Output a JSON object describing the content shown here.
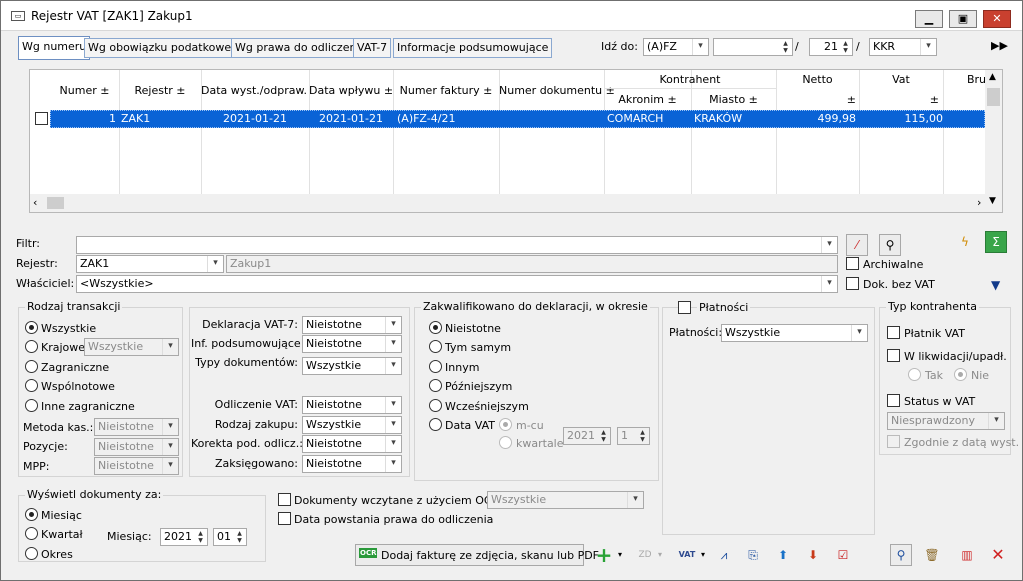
{
  "title": "Rejestr VAT  [ZAK1]  Zakup1",
  "tabs": [
    "Wg numeru",
    "Wg obowiązku podatkowego",
    "Wg prawa do odliczenia",
    "VAT-7",
    "Informacje podsumowujące"
  ],
  "goto": {
    "label": "Idź do:",
    "type": "(A)FZ",
    "number": "",
    "sep1": "/",
    "month": "21",
    "sep2": "/",
    "series": "KKR"
  },
  "grid": {
    "headers": {
      "numer": "Numer ±",
      "rejestr": "Rejestr ±",
      "data_wyst": "Data wyst./odpraw. ±",
      "data_wplywu": "Data wpływu ±",
      "nr_faktury": "Numer faktury ±",
      "nr_dok": "Numer dokumentu ±",
      "kontrahent": "Kontrahent",
      "akronim": "Akronim ±",
      "miasto": "Miasto ±",
      "netto": "Netto",
      "netto_sort": "±",
      "vat": "Vat",
      "vat_sort": "±",
      "brutto": "Bru"
    },
    "row": {
      "numer": "1",
      "rejestr": "ZAK1",
      "data_wyst": "2021-01-21",
      "data_wplywu": "2021-01-21",
      "nr_faktury": "(A)FZ-4/21",
      "nr_dok": "",
      "akronim": "COMARCH",
      "miasto": "KRAKÓW",
      "netto": "499,98",
      "vat": "115,00"
    }
  },
  "filter": {
    "filtr_label": "Filtr:",
    "filtr_value": "",
    "rejestr_label": "Rejestr:",
    "rejestr_value": "ZAK1",
    "rejestr_name": "Zakup1",
    "wlasciciel_label": "Właściciel:",
    "wlasciciel_value": "<Wszystkie>",
    "archiwalne": "Archiwalne",
    "dok_bez_vat": "Dok. bez VAT"
  },
  "rodzaj": {
    "title": "Rodzaj transakcji",
    "wszystkie": "Wszystkie",
    "krajowe": "Krajowe",
    "krajowe_value": "Wszystkie",
    "zagraniczne": "Zagraniczne",
    "wspolnotowe": "Wspólnotowe",
    "inne": "Inne zagraniczne",
    "metoda_label": "Metoda kas.:",
    "metoda_value": "Nieistotne",
    "pozycje_label": "Pozycje:",
    "pozycje_value": "Nieistotne",
    "mpp_label": "MPP:",
    "mpp_value": "Nieistotne"
  },
  "deklaracje": {
    "vat7_label": "Deklaracja VAT-7:",
    "vat7_value": "Nieistotne",
    "inf_label": "Inf. podsumowujące:",
    "inf_value": "Nieistotne",
    "typy_label": "Typy dokumentów:",
    "typy_value": "Wszystkie",
    "odl_label": "Odliczenie VAT:",
    "odl_value": "Nieistotne",
    "rodz_label": "Rodzaj zakupu:",
    "rodz_value": "Wszystkie",
    "kor_label": "Korekta pod. odlicz.:",
    "kor_value": "Nieistotne",
    "zaks_label": "Zaksięgowano:",
    "zaks_value": "Nieistotne"
  },
  "kwal": {
    "title": "Zakwalifikowano do deklaracji, w okresie",
    "nieistotne": "Nieistotne",
    "tym": "Tym samym",
    "innym": "Innym",
    "pozn": "Późniejszym",
    "wczes": "Wcześniejszym",
    "data_vat": "Data VAT",
    "mcu": "m-cu",
    "kwartale": "kwartale",
    "year": "2021",
    "q": "1"
  },
  "platnosci": {
    "title": "Płatności",
    "label": "Płatności:",
    "value": "Wszystkie"
  },
  "typk": {
    "title": "Typ kontrahenta",
    "platnik": "Płatnik VAT",
    "likw": "W likwidacji/upadł.",
    "tak": "Tak",
    "nie": "Nie",
    "status": "Status w VAT",
    "status_value": "Niesprawdzony",
    "zgodnie": "Zgodnie z datą wyst."
  },
  "wysw": {
    "title": "Wyświetl dokumenty za:",
    "miesiac": "Miesiąc",
    "kwartal": "Kwartał",
    "okres": "Okres",
    "mies_label": "Miesiąc:",
    "year": "2021",
    "month": "01"
  },
  "ocr": {
    "label": "Dokumenty wczytane z użyciem OCR",
    "value": "Wszystkie",
    "data_prawa": "Data powstania prawa do odliczenia",
    "add_button": "Dodaj fakturę ze zdjęcia, skanu lub PDF"
  }
}
